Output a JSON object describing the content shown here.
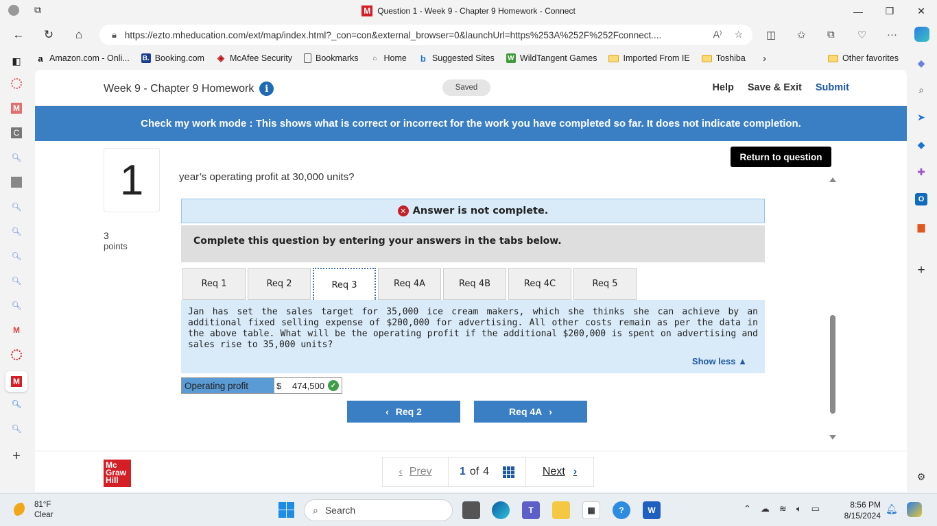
{
  "browser": {
    "window_title": "Question 1 - Week 9 - Chapter 9 Homework - Connect",
    "url": "https://ezto.mheducation.com/ext/map/index.html?_con=con&external_browser=0&launchUrl=https%253A%252F%252Fconnect....",
    "tab_logo": "M",
    "favorites": [
      {
        "label": "Amazon.com - Onli...",
        "icon": "amazon-icon"
      },
      {
        "label": "Booking.com",
        "icon": "booking-icon"
      },
      {
        "label": "McAfee Security",
        "icon": "mcafee-icon"
      },
      {
        "label": "Bookmarks",
        "icon": "page-icon"
      },
      {
        "label": "Home",
        "icon": "home-icon"
      },
      {
        "label": "Suggested Sites",
        "icon": "bing-icon"
      },
      {
        "label": "WildTangent Games",
        "icon": "wildtangent-icon"
      },
      {
        "label": "Imported From IE",
        "icon": "folder-icon"
      },
      {
        "label": "Toshiba",
        "icon": "folder-icon"
      }
    ],
    "other_favorites": "Other favorites"
  },
  "header": {
    "title": "Week 9 - Chapter 9 Homework",
    "saved": "Saved",
    "help": "Help",
    "save_exit": "Save & Exit",
    "submit": "Submit"
  },
  "banner": "Check my work mode : This shows what is correct or incorrect for the work you have completed so far. It does not indicate completion.",
  "question": {
    "number": "1",
    "points_value": "3",
    "points_label": "points",
    "return_button": "Return to question",
    "text": "year’s operating profit at 30,000 units?",
    "notice": "Answer is not complete.",
    "instruction": "Complete this question by entering your answers in the tabs below.",
    "tabs": [
      "Req 1",
      "Req 2",
      "Req 3",
      "Req 4A",
      "Req 4B",
      "Req 4C",
      "Req 5"
    ],
    "active_tab": "Req 3",
    "content": "Jan has set the sales target for 35,000 ice cream makers, which she thinks she can achieve by an additional fixed selling expense of $200,000 for advertising. All other costs remain as per the data in the above table. What will be the operating profit if the additional $200,000 is spent on advertising and sales rise to 35,000 units?",
    "show_less": "Show less",
    "answer_label": "Operating profit",
    "answer_currency": "$",
    "answer_value": "474,500",
    "prev_button": "Req 2",
    "next_button": "Req 4A"
  },
  "footer": {
    "logo": [
      "Mc",
      "Graw",
      "Hill"
    ],
    "prev": "Prev",
    "page_current": "1",
    "page_of": "of",
    "page_total": "4",
    "next": "Next"
  },
  "taskbar": {
    "temperature": "81°F",
    "weather": "Clear",
    "search": "Search",
    "time": "8:56 PM",
    "date": "8/15/2024"
  },
  "colors": {
    "brand_red": "#d51f26",
    "banner_blue": "#3a7fc4",
    "link_blue": "#1f59a3",
    "notice_bg": "#d9ebf9",
    "correct_green": "#3d9e4a"
  }
}
